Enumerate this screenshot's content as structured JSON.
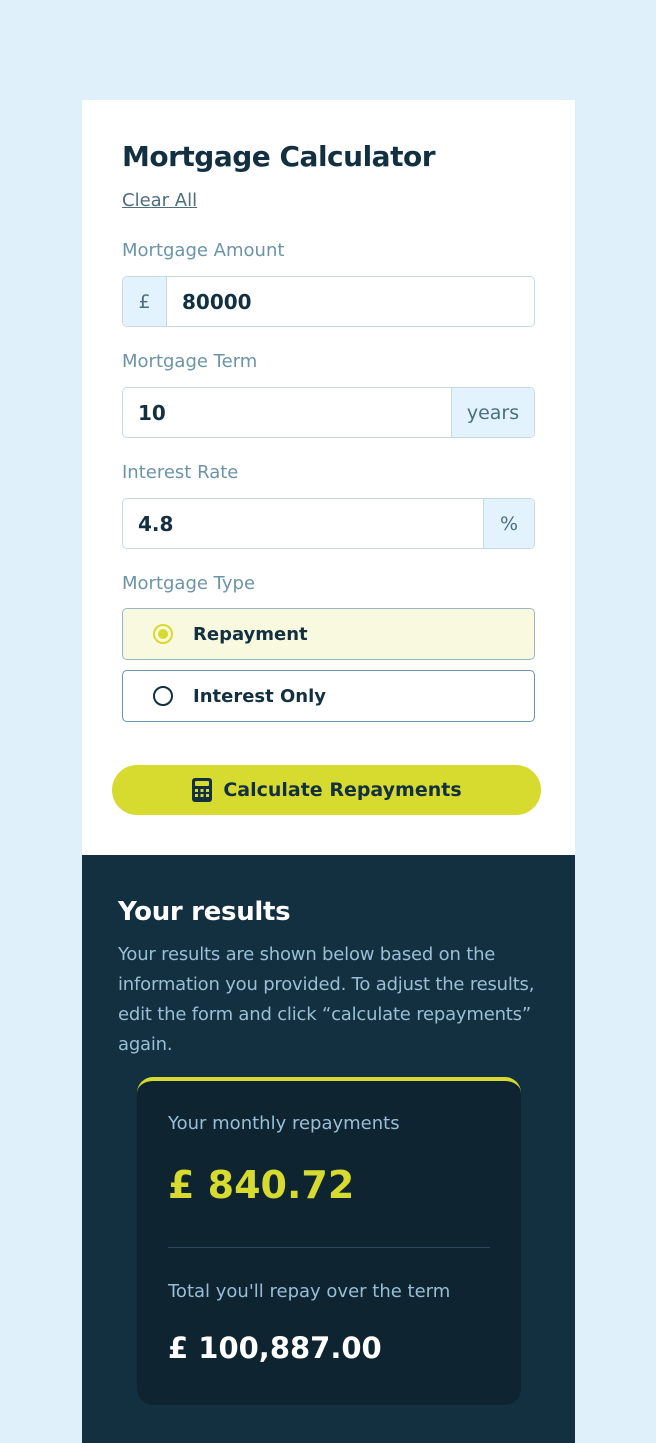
{
  "app": {
    "title": "Mortgage Calculator",
    "clear_all": "Clear All"
  },
  "fields": {
    "amount": {
      "label": "Mortgage Amount",
      "prefix": "£",
      "value": "80000"
    },
    "term": {
      "label": "Mortgage Term",
      "value": "10",
      "suffix": "years"
    },
    "rate": {
      "label": "Interest Rate",
      "value": "4.8",
      "suffix": "%"
    }
  },
  "mortgage_type": {
    "label": "Mortgage Type",
    "options": [
      {
        "label": "Repayment",
        "selected": true
      },
      {
        "label": "Interest Only",
        "selected": false
      }
    ]
  },
  "calculate_button": {
    "label": "Calculate Repayments",
    "icon": "calculator-icon"
  },
  "results": {
    "title": "Your results",
    "description": "Your results are shown below based on the information you provided. To adjust the results, edit the form and click “calculate repayments” again.",
    "monthly_label": "Your monthly repayments",
    "monthly_value": "£ 840.72",
    "total_label": "Total you'll repay over the term",
    "total_value": "£ 100,887.00"
  },
  "colors": {
    "background": "#e0f0fb",
    "dark": "#133041",
    "accent": "#d7da2f",
    "muted": "#6b94a8"
  }
}
